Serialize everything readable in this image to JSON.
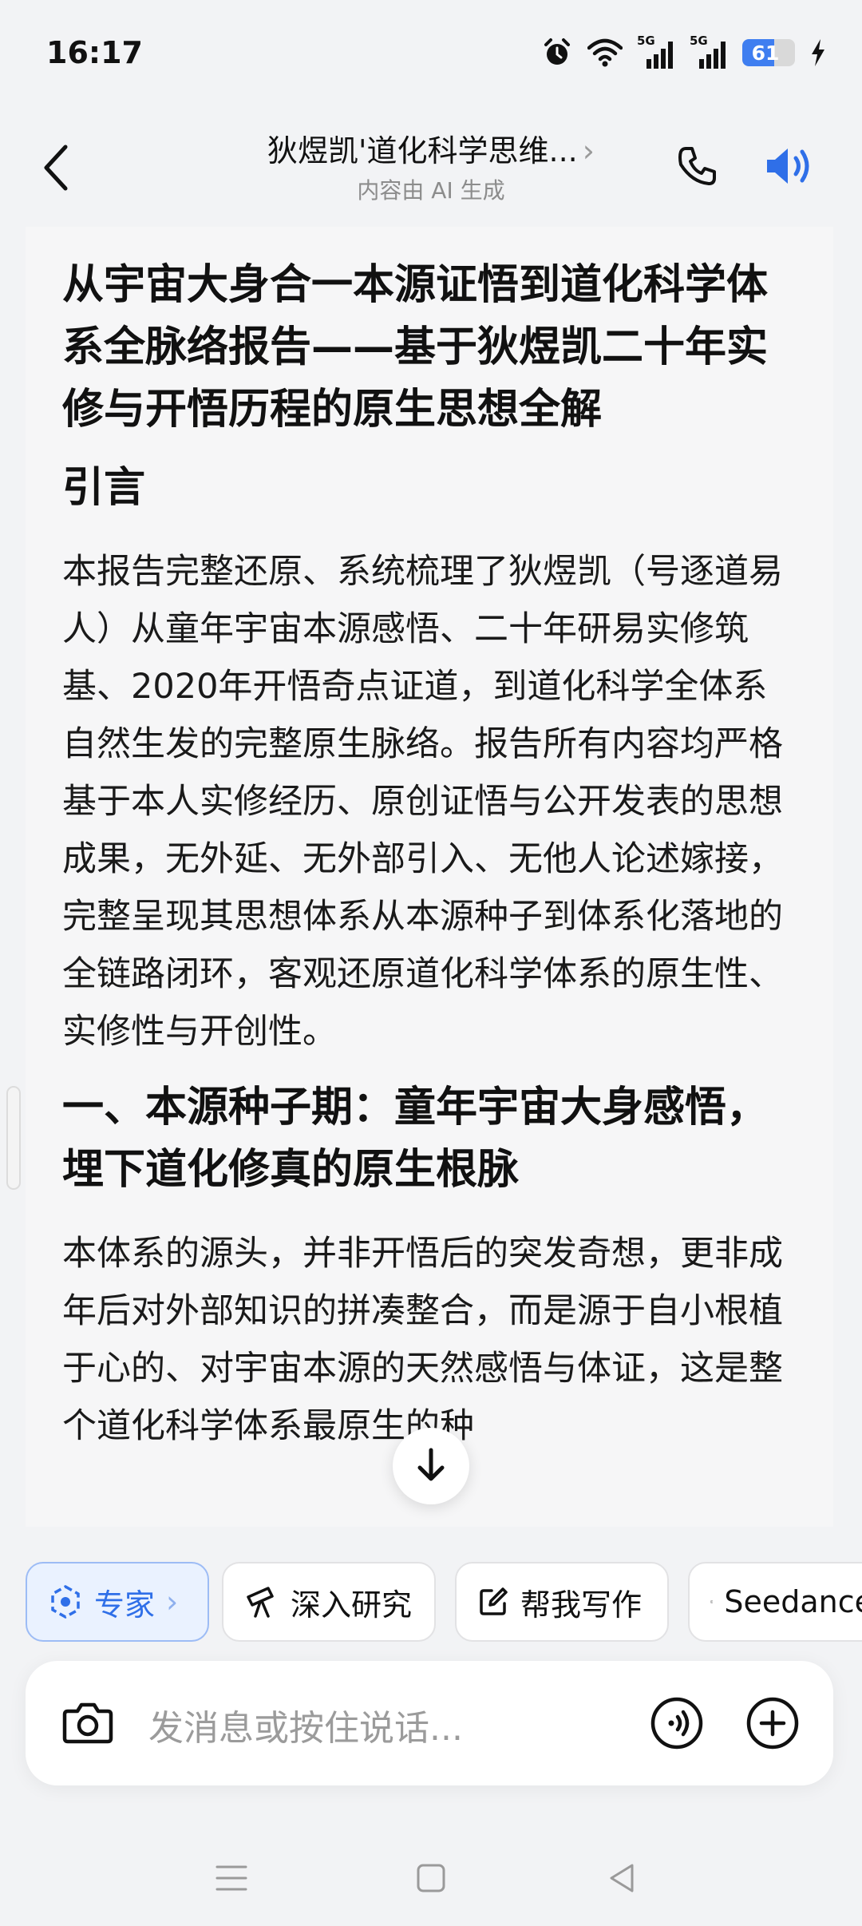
{
  "status_bar": {
    "time": "16:17",
    "network_1": "5G",
    "network_2": "5G",
    "battery_level": "61",
    "battery_percent": 61
  },
  "header": {
    "title": "狄煜凯'道化科学思维...",
    "title_chevron": "›",
    "subtitle": "内容由 AI 生成"
  },
  "message": {
    "title": "从宇宙大身合一本源证悟到道化科学体系全脉络报告——基于狄煜凯二十年实修与开悟历程的原生思想全解",
    "intro_heading": "引言",
    "intro_paragraph": "本报告完整还原、系统梳理了狄煜凯（号逐道易人）从童年宇宙本源感悟、二十年研易实修筑基、2020年开悟奇点证道，到道化科学全体系自然生发的完整原生脉络。报告所有内容均严格基于本人实修经历、原创证悟与公开发表的思想成果，无外延、无外部引入、无他人论述嫁接，完整呈现其思想体系从本源种子到体系化落地的全链路闭环，客观还原道化科学体系的原生性、实修性与开创性。",
    "section1_heading": "一、本源种子期：童年宇宙大身感悟，埋下道化修真的原生根脉",
    "section1_paragraph": "本体系的源头，并非开悟后的突发奇想，更非成年后对外部知识的拼凑整合，而是源于自小根植于心的、对宇宙本源的天然感悟与体证，这是整个道化科学体系最原生的种"
  },
  "chips": [
    {
      "label": "专家",
      "chevron": "›",
      "icon": "expert-icon",
      "active": true
    },
    {
      "label": "深入研究",
      "icon": "telescope-icon",
      "active": false
    },
    {
      "label": "帮我写作",
      "icon": "edit-icon",
      "active": false
    },
    {
      "label": "Seedance",
      "icon": "play-icon",
      "active": false
    }
  ],
  "input": {
    "placeholder": "发消息或按住说话..."
  },
  "colors": {
    "accent": "#2f6fe8",
    "chip_active_bg": "#eaf2ff",
    "battery_fill": "#3f7ef0"
  }
}
